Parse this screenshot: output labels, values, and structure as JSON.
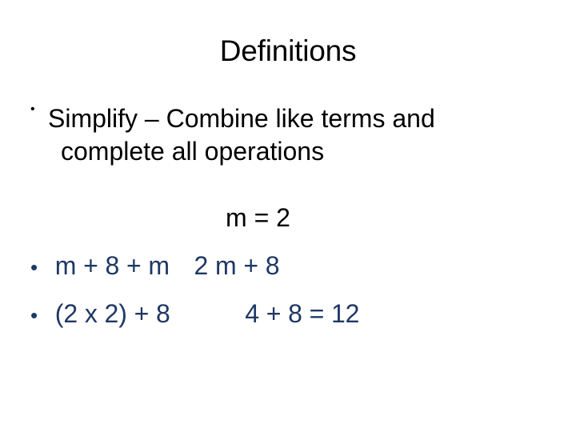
{
  "slide": {
    "title": "Definitions",
    "background_color": "#ffffff",
    "title_color": "#000000",
    "accent_color": "#1f3864",
    "bullet_glyph": "•",
    "content": {
      "bullet_1": {
        "marker": "•",
        "line_1": "Simplify – Combine like terms and",
        "line_2": "complete all operations",
        "color": "#000000"
      },
      "equation_centered": {
        "text": "m = 2",
        "color": "#000000"
      },
      "bullet_2": {
        "marker": "•",
        "text": "m + 8 + m",
        "text_tail": "2 m + 8",
        "color": "#1f3864"
      },
      "bullet_3": {
        "marker": "•",
        "text": "(2 x 2) + 8",
        "result": "4 + 8 = 12",
        "color": "#1f3864"
      }
    }
  }
}
